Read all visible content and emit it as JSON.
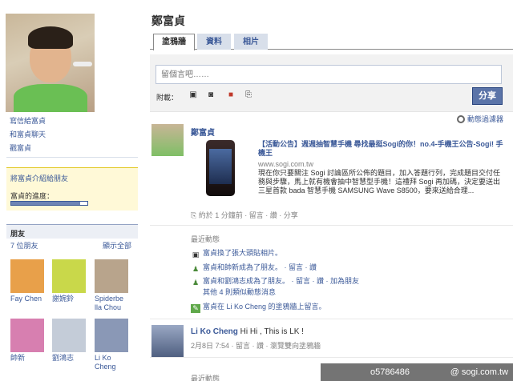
{
  "profile": {
    "name": "鄭富貞",
    "left_links": [
      "寫信給富貞",
      "和富貞聊天",
      "戳富貞"
    ],
    "intro_link": "將富貞介紹給朋友",
    "progress_label": "富貞的進度：",
    "progress_value": 0.9
  },
  "friends": {
    "header": "朋友",
    "count": "7 位朋友",
    "see_all": "顯示全部",
    "items": [
      {
        "name": "Fay Chen",
        "color": "#e8a04a"
      },
      {
        "name": "謝婉鈴",
        "color": "#c9d84a"
      },
      {
        "name": "Spiderbe lla Chou",
        "color": "#b8a48c"
      },
      {
        "name": "帥新",
        "color": "#d77fb0"
      },
      {
        "name": "劉鴻志",
        "color": "#c4ccd8"
      },
      {
        "name": "Li Ko Cheng",
        "color": "#8a98b6"
      }
    ]
  },
  "tabs": [
    "塗鴉牆",
    "資料",
    "相片"
  ],
  "composer": {
    "placeholder": "留個言吧……",
    "attach_label": "附載：",
    "attach_icons": [
      "photo-icon",
      "video-icon",
      "gift-icon",
      "link-icon"
    ],
    "share": "分享"
  },
  "filter": "動態過濾器",
  "story1": {
    "author": "鄭富貞",
    "title": "【活動公告】週週抽智慧手機 尋找最挺Sogi的你！no.4-手機王公告-Sogi! 手機王",
    "url": "www.sogi.com.tw",
    "description": "現在你只要關注 Sogi 討論區所公佈的題目，加入答題行列，完成題目交付任務與步驟，馬上就有機會抽中智慧型手機！這禮拜 Sogi 再加碼，決定要送出三星首款 bada 智慧手機 SAMSUNG Wave S8500，要來送給合理...",
    "meta": "約於 1 分鐘前 · 留言 · 讚 · 分享"
  },
  "recent": {
    "title": "最近動態",
    "rows": [
      {
        "icon": "photo-icon",
        "text": "富貞換了張大頭貼相片。"
      },
      {
        "icon": "friends-icon",
        "text": "富貞和帥新成為了朋友。 · 留言 · 讚"
      },
      {
        "icon": "friends-icon",
        "text": "富貞和劉鴻志成為了朋友。 · 留言 · 讚 · 加為朋友"
      },
      {
        "icon": "",
        "text": "其他 4 則類似動態消息"
      },
      {
        "icon": "wall-icon",
        "text": "富貞在 Li Ko Cheng 的塗鴉牆上留言。"
      }
    ]
  },
  "story2": {
    "author": "Li Ko Cheng",
    "message": "Hi Hi , This is LK !",
    "meta": "2月8日 7:54 · 留言 · 讚 · 瀏覽雙向塗鴉牆"
  },
  "recent2_title": "最近動態",
  "watermark": {
    "id": "o5786486",
    "site": "@ sogi.com.tw"
  }
}
